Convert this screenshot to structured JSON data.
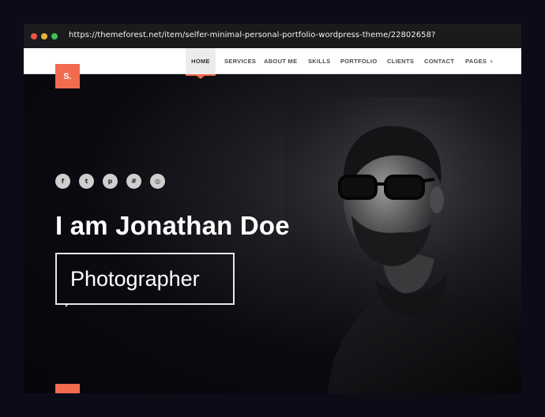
{
  "browser": {
    "url": "https://themeforest.net/item/selfer-minimal-personal-portfolio-wordpress-theme/22802658?",
    "dots": [
      "#e5534b",
      "#e5b23f",
      "#3fbf5a"
    ]
  },
  "site": {
    "logo": "S.",
    "accent_color": "#f26b4f",
    "nav": {
      "items": [
        {
          "label": "HOME",
          "active": true
        },
        {
          "label": "SERVICES",
          "active": false
        },
        {
          "label": "ABOUT ME",
          "active": false
        },
        {
          "label": "SKILLS",
          "active": false
        },
        {
          "label": "PORTFOLIO",
          "active": false
        },
        {
          "label": "CLIENTS",
          "active": false
        },
        {
          "label": "CONTACT",
          "active": false
        },
        {
          "label": "PAGES",
          "active": false,
          "has_dropdown": true
        }
      ]
    },
    "socials": [
      {
        "name": "facebook-icon",
        "glyph": "f"
      },
      {
        "name": "twitter-icon",
        "glyph": "t"
      },
      {
        "name": "pinterest-icon",
        "glyph": "p"
      },
      {
        "name": "slack-icon",
        "glyph": "#"
      },
      {
        "name": "instagram-icon",
        "glyph": "◎"
      }
    ],
    "hero": {
      "headline": "I am Jonathan Doe",
      "role": "Photographer",
      "scroll_icon": "+"
    }
  }
}
